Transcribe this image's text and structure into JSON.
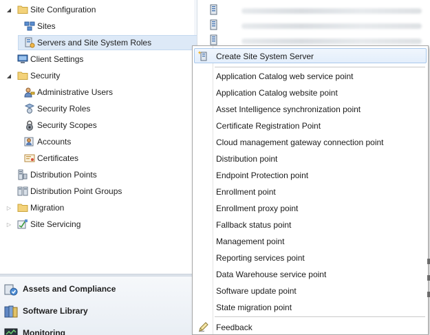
{
  "tree": {
    "items": [
      {
        "label": "Site Configuration",
        "icon": "folder-icon",
        "expander": "expanded"
      },
      {
        "label": "Sites",
        "icon": "sites-icon"
      },
      {
        "label": "Servers and Site System Roles",
        "icon": "server-roles-icon",
        "selected": true
      },
      {
        "label": "Client Settings",
        "icon": "client-settings-icon"
      },
      {
        "label": "Security",
        "icon": "folder-icon",
        "expander": "expanded"
      },
      {
        "label": "Administrative Users",
        "icon": "admin-users-icon"
      },
      {
        "label": "Security Roles",
        "icon": "security-roles-icon"
      },
      {
        "label": "Security Scopes",
        "icon": "security-scopes-icon"
      },
      {
        "label": "Accounts",
        "icon": "accounts-icon"
      },
      {
        "label": "Certificates",
        "icon": "certificates-icon"
      },
      {
        "label": "Distribution Points",
        "icon": "distribution-points-icon"
      },
      {
        "label": "Distribution Point Groups",
        "icon": "distribution-point-groups-icon"
      },
      {
        "label": "Migration",
        "icon": "folder-icon",
        "expander": "collapsed"
      },
      {
        "label": "Site Servicing",
        "icon": "site-servicing-icon",
        "expander": "collapsed"
      }
    ]
  },
  "workspaces": {
    "items": [
      {
        "label": "Assets and Compliance",
        "icon": "assets-compliance-icon"
      },
      {
        "label": "Software Library",
        "icon": "software-library-icon"
      },
      {
        "label": "Monitoring",
        "icon": "monitoring-icon"
      }
    ]
  },
  "context_menu": {
    "top_item": {
      "label": "Create Site System Server",
      "icon": "create-server-icon"
    },
    "roles": [
      "Application Catalog web service point",
      "Application Catalog website point",
      "Asset Intelligence synchronization point",
      "Certificate Registration Point",
      "Cloud management gateway connection point",
      "Distribution point",
      "Endpoint Protection point",
      "Enrollment point",
      "Enrollment proxy point",
      "Fallback status point",
      "Management point",
      "Reporting services point",
      "Data Warehouse service point",
      "Software update point",
      "State migration point"
    ],
    "feedback": {
      "label": "Feedback",
      "icon": "feedback-icon"
    }
  },
  "colors": {
    "selection": "#dde9f7",
    "menu_highlight_border": "#a8c8ec",
    "folder": "#e8c25a"
  }
}
